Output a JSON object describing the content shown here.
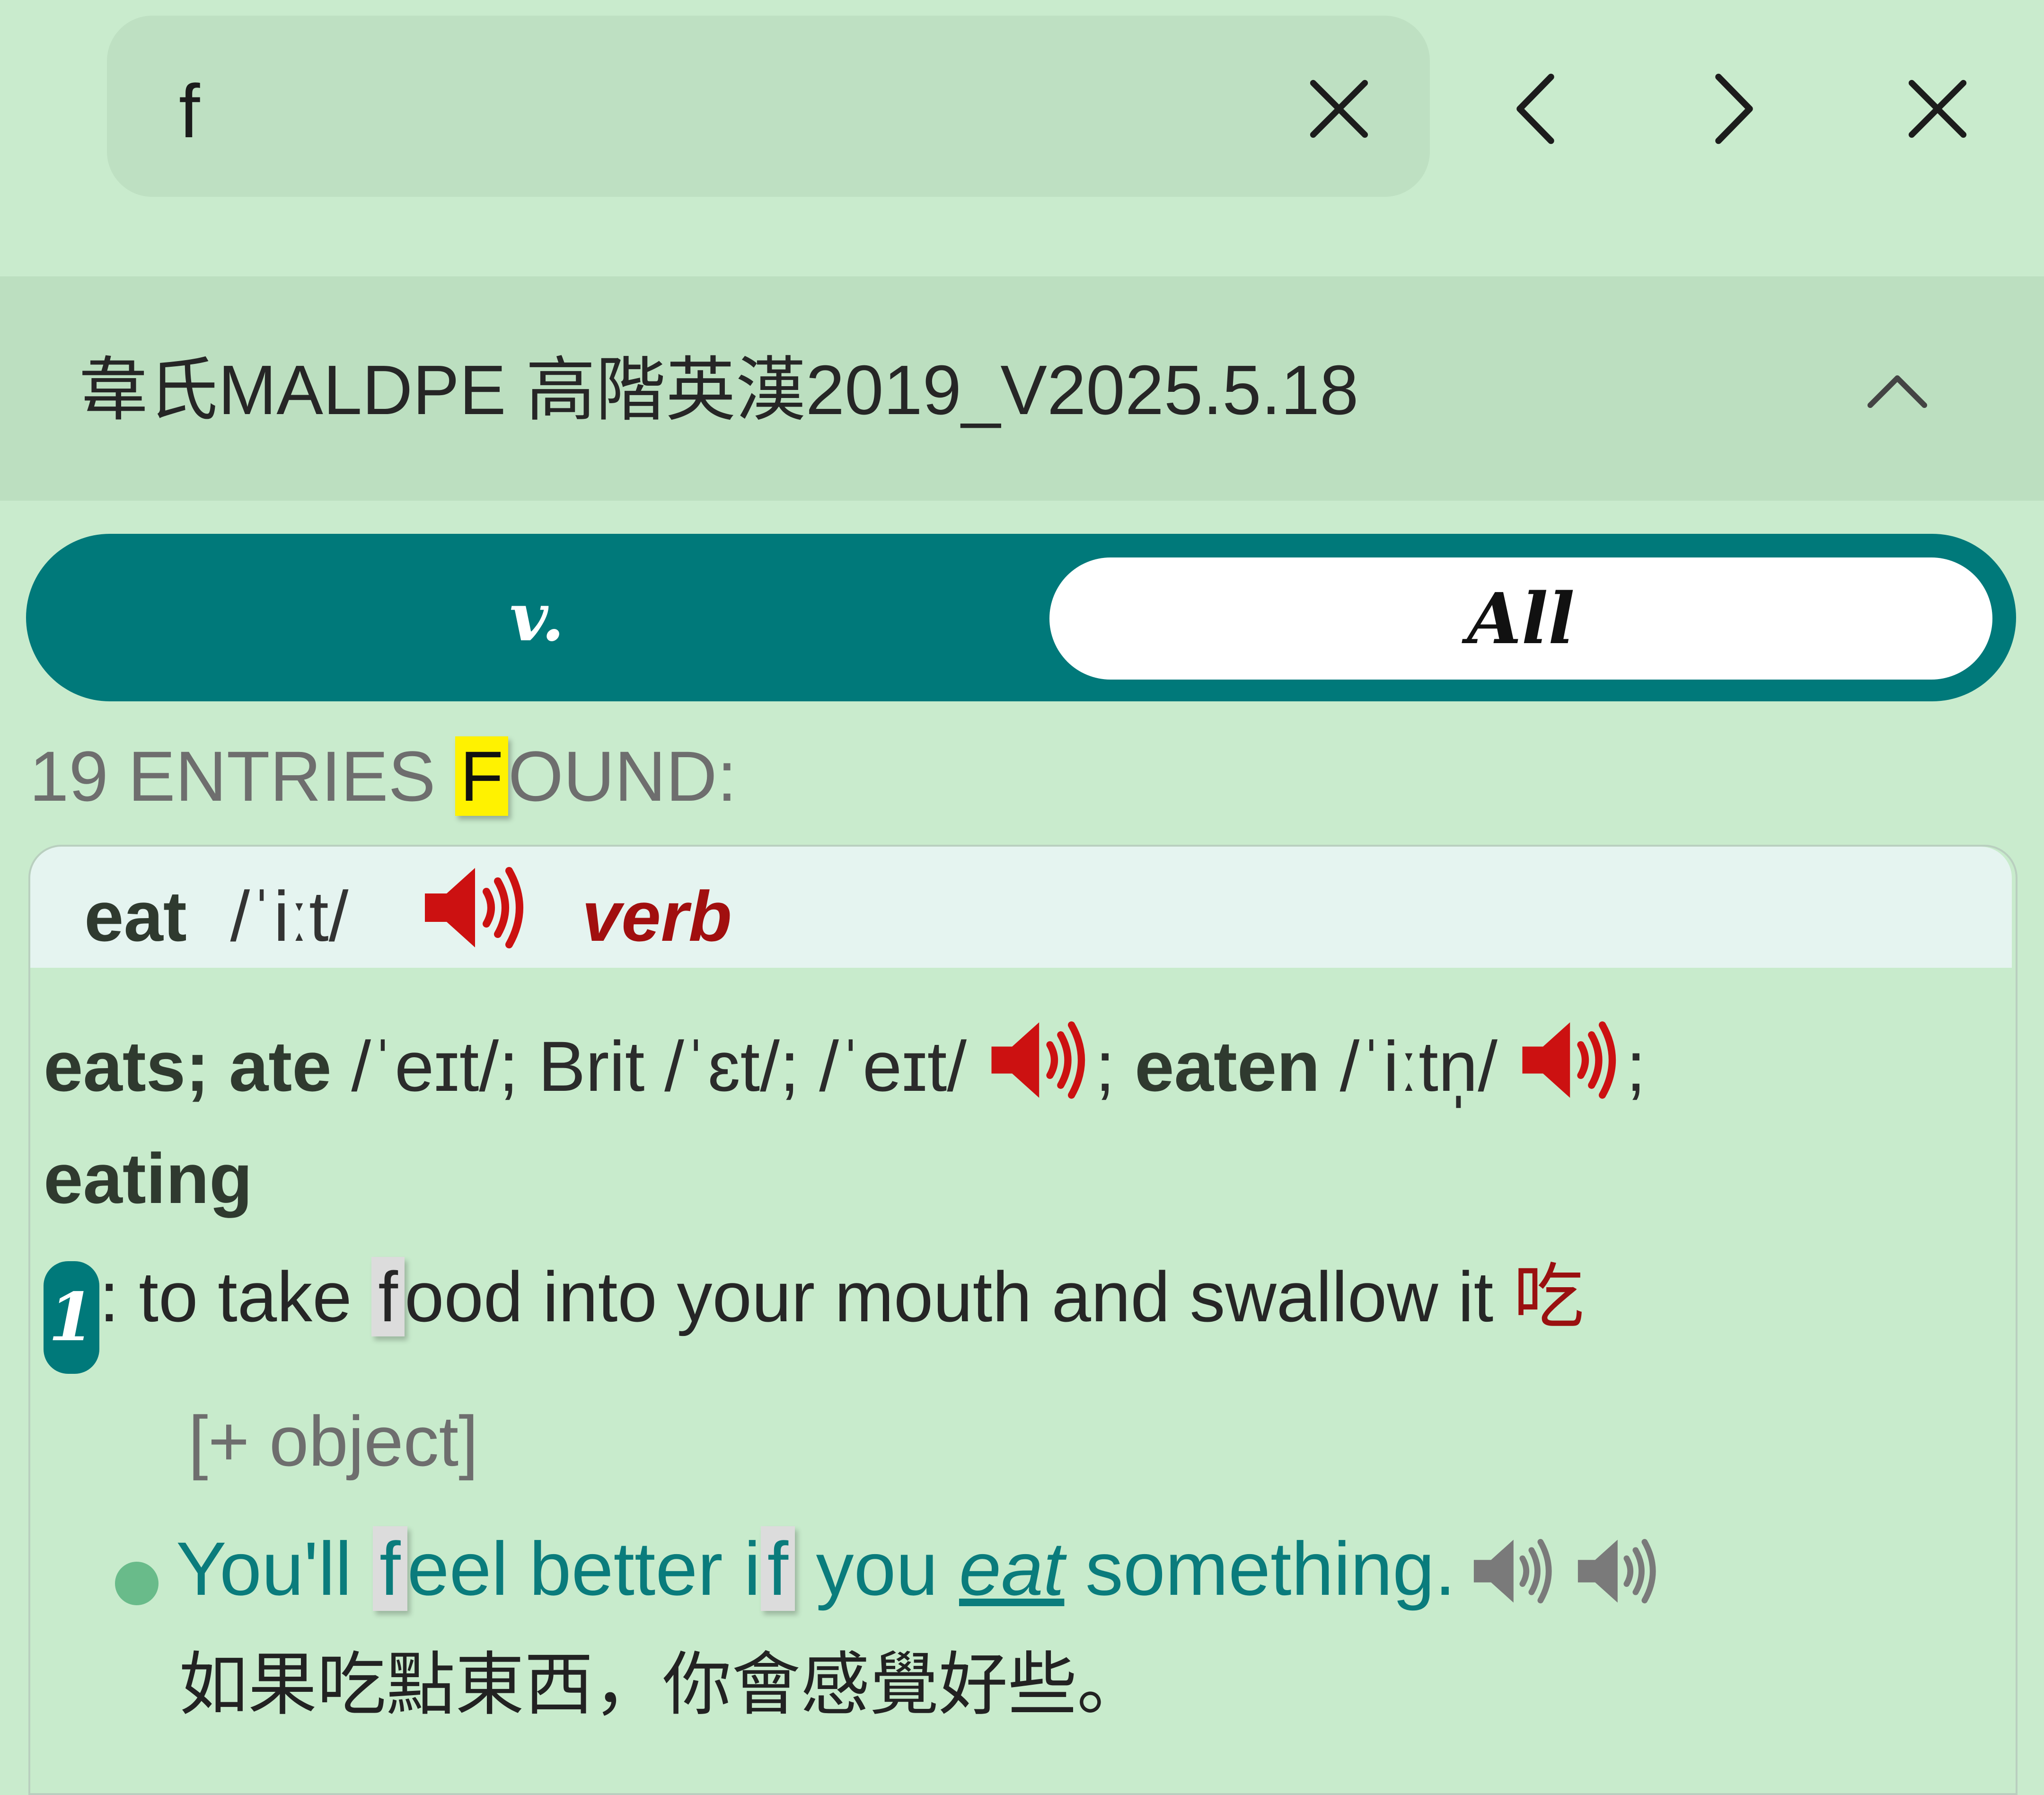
{
  "find_bar": {
    "query": "f",
    "icons": {
      "clear": "close-icon",
      "previous": "chevron-left-icon",
      "next": "chevron-right-icon",
      "close": "close-icon"
    }
  },
  "dictionary": {
    "title": "韋氏MALDPE 高階英漢2019_V2025.5.18",
    "collapse_icon": "chevron-up-icon"
  },
  "filter": {
    "pos_label": "v.",
    "all_label": "All",
    "selected": "All"
  },
  "results": {
    "count_before": "19 ENTRIES ",
    "count_highlight": "F",
    "count_after": "OUND:"
  },
  "entry": {
    "headword": "eat",
    "pronunciation": "/ˈiːt/",
    "part_of_speech": "verb",
    "forms": {
      "eats_ate": "eats; ate",
      "ate_pron": " /ˈeɪt/; Brit /ˈɛt/; /ˈeɪt/ ",
      "sep1": "; ",
      "eaten": "eaten",
      "eaten_pron": " /ˈiːtn̩/ ",
      "sep2": ";",
      "eating": "eating"
    },
    "sense": {
      "number": "1",
      "def_before": ": to take ",
      "def_highlight": "f",
      "def_after": "ood into your mouth and swallow it ",
      "chinese": "吃",
      "grammar": "[+ object]"
    },
    "example": {
      "part1": "You'll ",
      "hl1": "f",
      "part2": "eel better i",
      "hl2": "f",
      "part3": " you ",
      "keyword": "eat",
      "part4": " something.",
      "translation": "如果吃點東西，你會感覺好些。"
    }
  },
  "colors": {
    "background": "#c9ebcd",
    "accent": "#00797a",
    "speaker_red": "#cc1111",
    "highlight_yellow": "#fff200"
  }
}
